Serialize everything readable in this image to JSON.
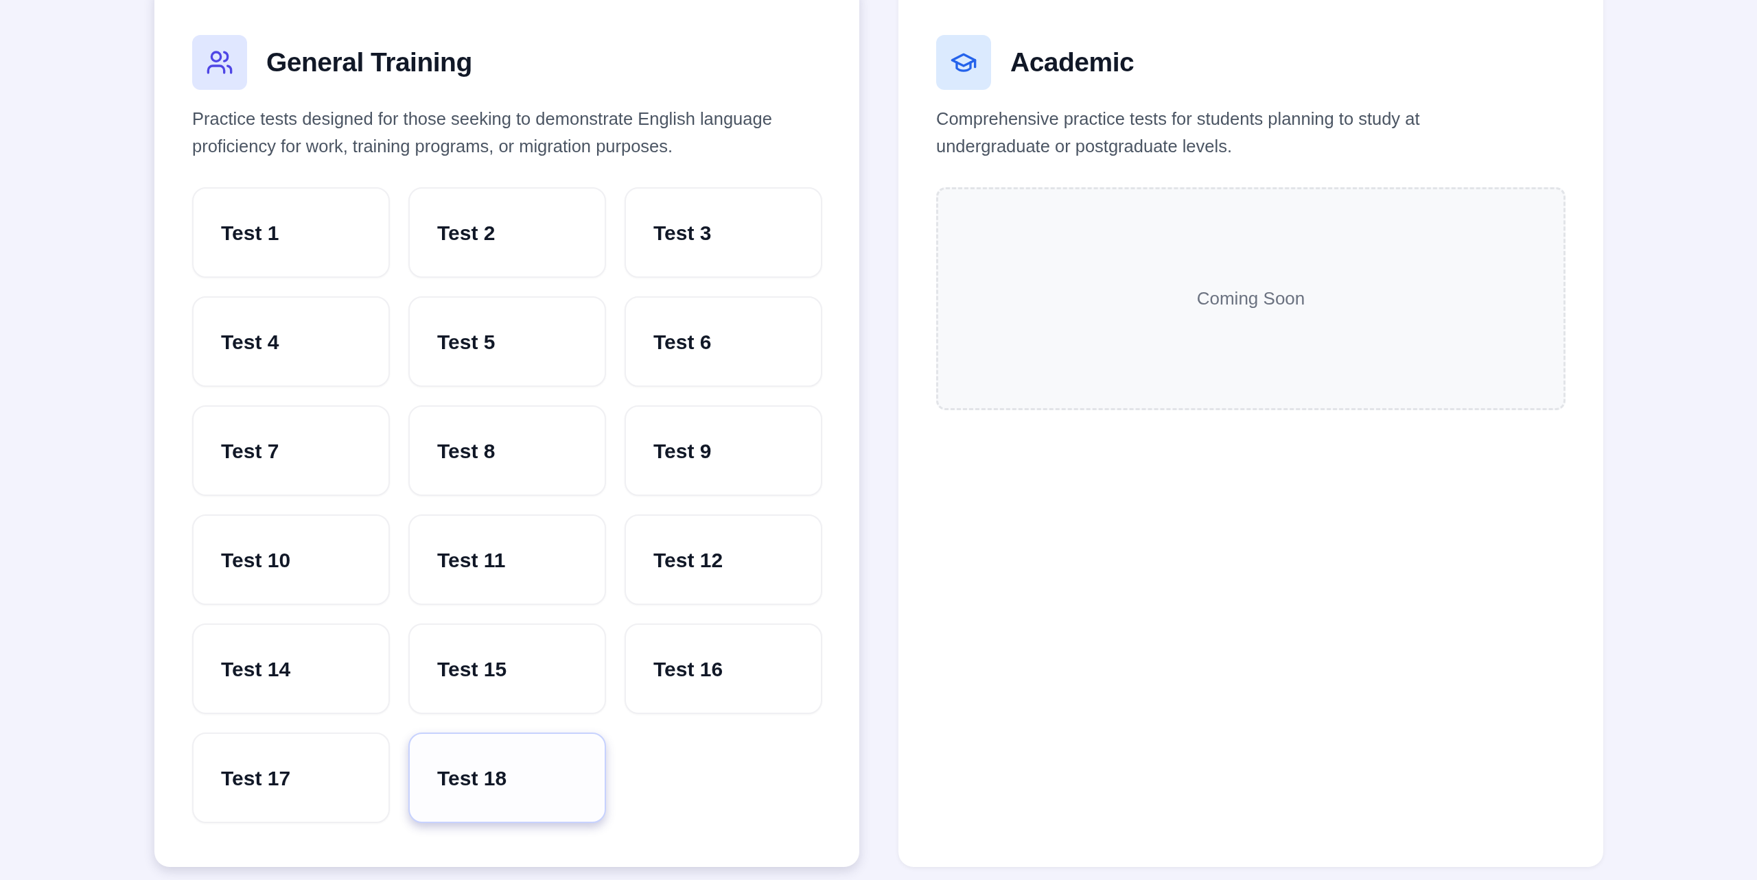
{
  "sections": [
    {
      "kind": "general",
      "title": "General Training",
      "description": "Practice tests designed for those seeking to demonstrate English language proficiency for work, training programs, or migration purposes.",
      "hovered": true,
      "tests": [
        {
          "label": "Test 1",
          "selected": false
        },
        {
          "label": "Test 2",
          "selected": false
        },
        {
          "label": "Test 3",
          "selected": false
        },
        {
          "label": "Test 4",
          "selected": false
        },
        {
          "label": "Test 5",
          "selected": false
        },
        {
          "label": "Test 6",
          "selected": false
        },
        {
          "label": "Test 7",
          "selected": false
        },
        {
          "label": "Test 8",
          "selected": false
        },
        {
          "label": "Test 9",
          "selected": false
        },
        {
          "label": "Test 10",
          "selected": false
        },
        {
          "label": "Test 11",
          "selected": false
        },
        {
          "label": "Test 12",
          "selected": false
        },
        {
          "label": "Test 14",
          "selected": false
        },
        {
          "label": "Test 15",
          "selected": false
        },
        {
          "label": "Test 16",
          "selected": false
        },
        {
          "label": "Test 17",
          "selected": false
        },
        {
          "label": "Test 18",
          "selected": true
        }
      ]
    },
    {
      "kind": "academic",
      "title": "Academic",
      "description": "Comprehensive practice tests for students planning to study at undergraduate or postgraduate levels.",
      "hovered": false,
      "placeholder": "Coming Soon"
    }
  ]
}
